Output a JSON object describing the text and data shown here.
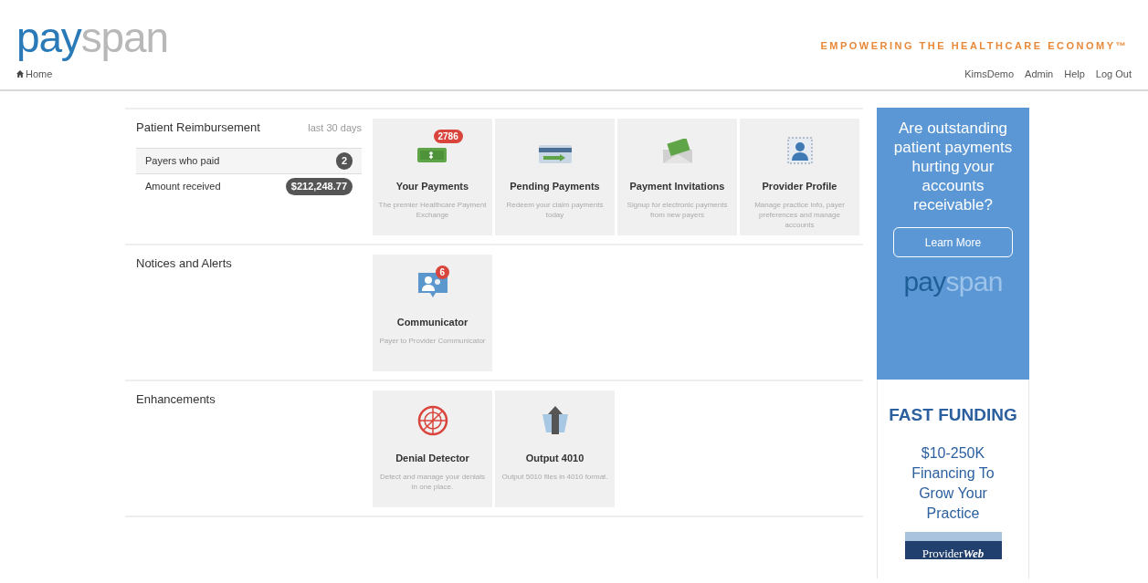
{
  "header": {
    "logo": {
      "first": "pay",
      "second": "span"
    },
    "tagline": "EMPOWERING THE HEALTHCARE ECONOMY™"
  },
  "nav": {
    "home": "Home",
    "links": [
      "KimsDemo",
      "Admin",
      "Help",
      "Log Out"
    ]
  },
  "sections": [
    {
      "title": "Patient Reimbursement",
      "period": "last 30 days",
      "stats": [
        {
          "label": "Payers who paid",
          "value": "2"
        },
        {
          "label": "Amount received",
          "value": "$212,248.77"
        }
      ],
      "tiles": [
        {
          "kind": "money",
          "badge": "2786",
          "title": "Your Payments",
          "description": "The premier Healthcare Payment Exchange"
        },
        {
          "kind": "card",
          "title": "Pending Payments",
          "description": "Redeem your claim payments today"
        },
        {
          "kind": "envelope",
          "title": "Payment Invitations",
          "description": "Signup for electronic payments from new payers"
        },
        {
          "kind": "profile",
          "title": "Provider Profile",
          "description": "Manage practice info, payer preferences and manage accounts"
        }
      ]
    },
    {
      "title": "Notices and Alerts",
      "tiles": [
        {
          "kind": "chat",
          "badge": "6",
          "title": "Communicator",
          "description": "Payer to Provider Communicator"
        }
      ]
    },
    {
      "title": "Enhancements",
      "tiles": [
        {
          "kind": "radar",
          "title": "Denial Detector",
          "description": "Detect and manage your denials in one place."
        },
        {
          "kind": "upload",
          "title": "Output 4010",
          "description": "Output 5010 files in 4010 format."
        }
      ]
    }
  ],
  "ads": [
    {
      "kind": "promo",
      "text": "Are outstanding patient payments hurting your accounts receivable?",
      "button": "Learn More",
      "logo": {
        "first": "pay",
        "second": "span"
      }
    },
    {
      "kind": "funding",
      "heading": "FAST FUNDING",
      "text": "$10-250K Financing To Grow Your Practice",
      "logo": {
        "first": "Provider",
        "second": "Web"
      }
    }
  ]
}
